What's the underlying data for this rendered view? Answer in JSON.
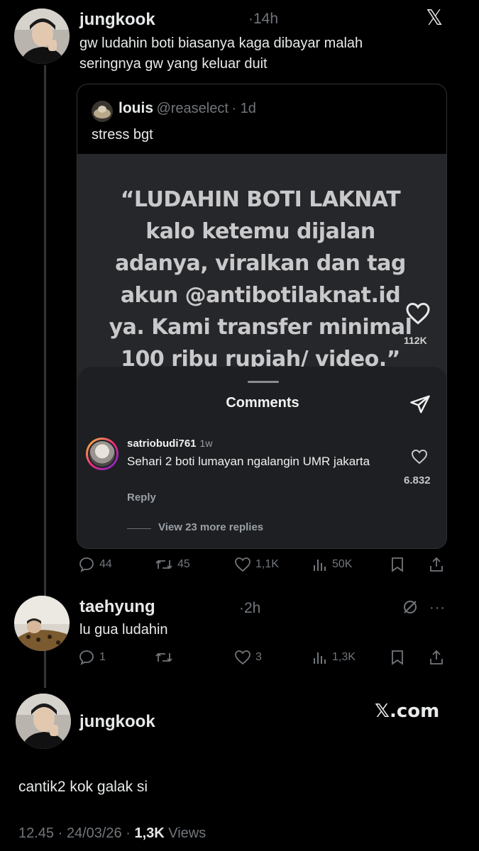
{
  "post1": {
    "name": "jungkook",
    "time": "·14h",
    "text_line1": "gw ludahin boti biasanya kaga dibayar malah",
    "text_line2": "seringnya gw yang keluar duit",
    "close_icon": "x-logo-icon",
    "quote": {
      "name": "louis",
      "handle": "@reaselect",
      "time": "· 1d",
      "text": "stress bgt",
      "media": {
        "lines": [
          "“LUDAHIN BOTI LAKNAT",
          "kalo ketemu dijalan",
          "adanya, viralkan dan tag",
          "akun @antibotilaknat.id",
          "ya. Kami transfer minimal",
          "100 ribu rupiah/ video.”"
        ],
        "like_count": "112K",
        "sheet_title": "Comments",
        "comment": {
          "user": "satriobudi761",
          "time": "1w",
          "text": "Sehari 2 boti lumayan ngalangin UMR jakarta",
          "reply_label": "Reply",
          "likes": "6.832",
          "view_replies": "View 23 more replies"
        }
      }
    },
    "stats": {
      "replies": "44",
      "reposts": "45",
      "likes": "1,1K",
      "views": "50K"
    }
  },
  "post2": {
    "name": "taehyung",
    "time": "·2h",
    "text": "lu gua ludahin",
    "stats": {
      "replies": "1",
      "reposts": "",
      "likes": "3",
      "views": "1,3K"
    }
  },
  "post3": {
    "name": "jungkook",
    "brand": "𝕏.com",
    "text": "cantik2 kok galak si",
    "footer_time": "12.45 · 24/03/26 · ",
    "footer_views": "1,3K",
    "footer_views_label": " Views"
  },
  "colors": {
    "background": "#000000",
    "text": "#e7e9ea",
    "muted": "#71767b",
    "card": "#1d1f22"
  }
}
